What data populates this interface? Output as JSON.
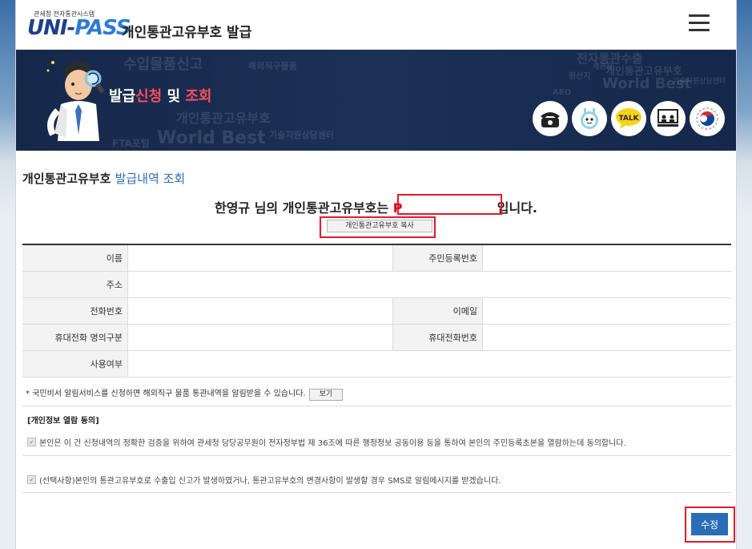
{
  "header": {
    "logo_small": "관세청 전자통관시스템",
    "logo_main_a": "UNI-",
    "logo_main_b": "PASS",
    "app_title": "개인통관고유부호 발급",
    "menu_icon": "hamburger-menu-icon"
  },
  "banner": {
    "title_a": "발급",
    "title_b": "신청",
    "title_c": " 및 ",
    "title_d": "조회",
    "watermarks": [
      "수입물품신고",
      "해외직구물품",
      "개인통관고유부호",
      "기술지원상담센터",
      "FTA포털",
      "World Best",
      "전자통관수출",
      "원산지",
      "기술지원상담센터",
      "세관장",
      "AEO",
      "World Best",
      "개인통관고유부호"
    ],
    "icons": [
      "phone-icon",
      "robot-chatbot-icon",
      "kakao-talk-icon",
      "remote-support-icon",
      "government-emblem-icon"
    ],
    "talk_label": "TALK"
  },
  "main": {
    "section_title_a": "개인통관고유부호 ",
    "section_title_b": "발급내역 조회",
    "message_prefix": "한영규 님의 개인통관고유부호는 ",
    "message_number": "P",
    "message_suffix": "입니다.",
    "copy_button": "개인통관고유부호 복사",
    "fields": {
      "name_label": "이름",
      "name_value": "",
      "rrn_label": "주민등록번호",
      "rrn_value": "",
      "address_label": "주소",
      "address_value": "",
      "phone_label": "전화번호",
      "phone_value": "",
      "email_label": "이메일",
      "email_value": "",
      "mobile_type_label": "휴대전화 명의구분",
      "mobile_type_value": "",
      "mobile_label": "휴대전화번호",
      "mobile_value": "",
      "usage_label": "사용여부",
      "usage_value": ""
    },
    "notice": "* 국민비서 알림서비스를 신청하면 해외직구 물품 통관내역을 알림받을 수 있습니다.",
    "view_button": "보기",
    "consent_title": "[개인정보 열람 동의]",
    "consent_1": "본인은 이 건 신청내역의 정확한 검증을 위하여 관세청 담당공무원이 전자정부법 제 36조에 따른 행정정보 공동이용 등을 통하여 본인의 주민등록초본을 열람하는데 동의합니다.",
    "consent_2": "(선택사항)본인의 통관고유부호로 수출입 신고가 발생하였거나, 통관고유부호의 변경사항이 발생할 경우 SMS로 알림메시지를 받겠습니다.",
    "edit_button": "수정"
  },
  "colors": {
    "accent_blue": "#2a6db5",
    "highlight_red": "#e0192d",
    "banner_bg": "#1c3056"
  }
}
